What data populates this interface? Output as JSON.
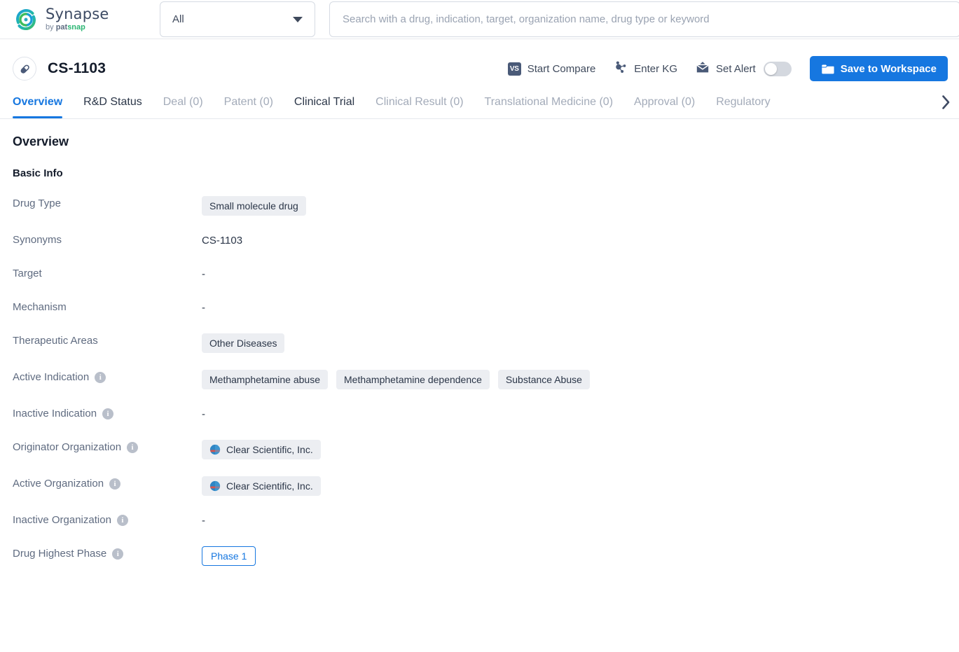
{
  "brand": {
    "name": "Synapse",
    "by": "by",
    "pat": "pat",
    "snap": "snap",
    "logo_icon": "synapse-swirl-logo"
  },
  "search": {
    "scope_value": "All",
    "placeholder": "Search with a drug, indication, target, organization name, drug type or keyword",
    "value": "",
    "caret_icon": "chevron-down-icon"
  },
  "drug_header": {
    "icon": "capsule-icon",
    "title": "CS-1103",
    "actions": [
      {
        "label": "Start Compare",
        "icon": "vs-icon",
        "icon_text": "VS"
      },
      {
        "label": "Enter KG",
        "icon": "knowledge-graph-icon"
      },
      {
        "label": "Set Alert",
        "icon": "alert-envelope-icon",
        "toggle": "off"
      }
    ],
    "save_button": {
      "label": "Save to Workspace",
      "icon": "folder-icon",
      "color": "#1677e0"
    }
  },
  "tabs": {
    "items": [
      {
        "label": "Overview",
        "state": "active"
      },
      {
        "label": "R&D Status",
        "state": "normal"
      },
      {
        "label": "Deal (0)",
        "state": "disabled"
      },
      {
        "label": "Patent (0)",
        "state": "disabled"
      },
      {
        "label": "Clinical Trial",
        "state": "normal"
      },
      {
        "label": "Clinical Result (0)",
        "state": "disabled"
      },
      {
        "label": "Translational Medicine (0)",
        "state": "disabled"
      },
      {
        "label": "Approval (0)",
        "state": "disabled"
      },
      {
        "label": "Regulatory",
        "state": "disabled"
      }
    ],
    "next_icon": "chevron-right-icon"
  },
  "overview": {
    "heading": "Overview",
    "section_title": "Basic Info",
    "rows": [
      {
        "label": "Drug Type",
        "info": false,
        "kind": "tags",
        "values": [
          "Small molecule drug"
        ]
      },
      {
        "label": "Synonyms",
        "info": false,
        "kind": "text",
        "values": [
          "CS-1103"
        ]
      },
      {
        "label": "Target",
        "info": false,
        "kind": "text",
        "values": [
          "-"
        ]
      },
      {
        "label": "Mechanism",
        "info": false,
        "kind": "text",
        "values": [
          "-"
        ]
      },
      {
        "label": "Therapeutic Areas",
        "info": false,
        "kind": "tags",
        "values": [
          "Other Diseases"
        ]
      },
      {
        "label": "Active Indication",
        "info": true,
        "kind": "tags",
        "values": [
          "Methamphetamine abuse",
          "Methamphetamine dependence",
          "Substance Abuse"
        ]
      },
      {
        "label": "Inactive Indication",
        "info": true,
        "kind": "text",
        "values": [
          "-"
        ]
      },
      {
        "label": "Originator Organization",
        "info": true,
        "kind": "org",
        "values": [
          "Clear Scientific, Inc."
        ]
      },
      {
        "label": "Active Organization",
        "info": true,
        "kind": "org",
        "values": [
          "Clear Scientific, Inc."
        ]
      },
      {
        "label": "Inactive Organization",
        "info": true,
        "kind": "text",
        "values": [
          "-"
        ]
      },
      {
        "label": "Drug Highest Phase",
        "info": true,
        "kind": "phase",
        "values": [
          "Phase 1"
        ]
      }
    ],
    "info_glyph": "i"
  }
}
